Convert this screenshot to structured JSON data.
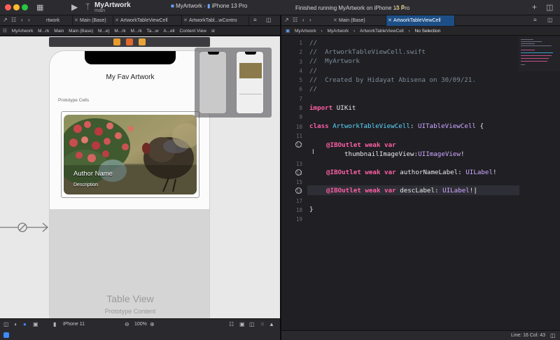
{
  "toolbar": {
    "scheme_name": "MyArtwork",
    "scheme_branch": "main",
    "target_scheme": "MyArtwork",
    "target_device": "iPhone 13 Pro",
    "status": "Finished running MyArtwork on iPhone 13 Pro",
    "warnings": "⚠ 5"
  },
  "tabs_left": [
    {
      "label": "rtwork"
    },
    {
      "label": "Main (Base)"
    },
    {
      "label": "ArtworkTableViewCell"
    },
    {
      "label": "ArtworkTabl...wContro"
    }
  ],
  "tabs_right": [
    {
      "label": "Main (Base)"
    },
    {
      "label": "ArtworkTableViewCell"
    }
  ],
  "jump_left": [
    "MyArtwork",
    "M...rk",
    "Main",
    "Main (Base)",
    "M...e)",
    "M...rk",
    "M...rk",
    "Ta...w",
    "A...ell",
    "Content View",
    "st"
  ],
  "jump_right": [
    "MyArtwork",
    "MyArtwork",
    "ArtworkTableViewCell",
    "No Selection"
  ],
  "canvas": {
    "nav_title": "My Fav Artwork",
    "section_header": "Prototype Cells",
    "author_label": "Author Name",
    "desc_label": "Description",
    "tableview_title": "Table View",
    "tableview_subtitle": "Prototype Content"
  },
  "bottom_left": {
    "device": "iPhone 11",
    "zoom": "100%"
  },
  "code_lines": [
    {
      "n": "1",
      "text": "//"
    },
    {
      "n": "2",
      "text": "//  ArtworkTableViewCell.swift"
    },
    {
      "n": "3",
      "text": "//  MyArtwork"
    },
    {
      "n": "4",
      "text": "//"
    },
    {
      "n": "5",
      "text": "//  Created by Hidayat Abisena on 30/09/21."
    },
    {
      "n": "6",
      "text": "//"
    },
    {
      "n": "7",
      "text": ""
    },
    {
      "n": "8",
      "text": "import UIKit"
    },
    {
      "n": "9",
      "text": ""
    },
    {
      "n": "10",
      "text": "class ArtworkTableViewCell: UITableViewCell {"
    },
    {
      "n": "11",
      "text": ""
    },
    {
      "n": "12",
      "text": "@IBOutlet weak var thumbnailImageView:UIImageView!"
    },
    {
      "n": "13",
      "text": ""
    },
    {
      "n": "14",
      "text": "@IBOutlet weak var authorNameLabel: UILabel!"
    },
    {
      "n": "15",
      "text": ""
    },
    {
      "n": "16",
      "text": "@IBOutlet weak var descLabel: UILabel!"
    },
    {
      "n": "17",
      "text": ""
    },
    {
      "n": "18",
      "text": "}"
    },
    {
      "n": "19",
      "text": ""
    }
  ],
  "code_tokens": {
    "comment2": "//  ArtworkTableViewCell.swift",
    "comment3": "//  MyArtwork",
    "comment5": "//  Created by Hidayat Abisena on 30/09/21.",
    "kw_import": "import",
    "mod_uikit": "UIKit",
    "kw_class": "class",
    "class_name": "ArtworkTableViewCell",
    "super_class": "UITableViewCell",
    "open_brace": " {",
    "ibo": "@IBOutlet",
    "kw_weak": "weak",
    "kw_var": "var",
    "var1": "thumbnailImageView",
    "type1": "UIImageView",
    "var2": "authorNameLabel",
    "type2": "UILabel",
    "var3": "descLabel",
    "type3": "UILabel",
    "close_brace": "}"
  },
  "status_bar": {
    "cursor": "Line: 16  Col: 43"
  },
  "colors": {
    "keyword": "#fc5fa3",
    "type": "#5dd8ff",
    "class_ref": "#d0a8ff",
    "comment": "#7f8c98",
    "active_tab": "#1d4f86"
  }
}
